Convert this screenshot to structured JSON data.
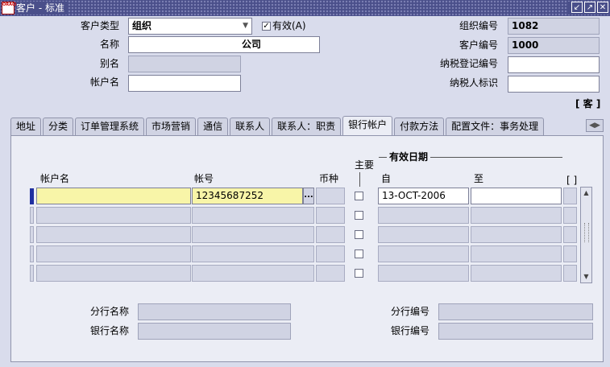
{
  "window": {
    "title": "客户 - 标准",
    "icon_text": "ORACLE"
  },
  "header": {
    "cust_type_label": "客户类型",
    "cust_type_value": "组织",
    "active_label": "有效(A)",
    "name_label": "名称",
    "name_value": "公司",
    "alias_label": "别名",
    "account_name_label": "帐户名",
    "org_number_label": "组织编号",
    "org_number_value": "1082",
    "cust_number_label": "客户编号",
    "cust_number_value": "1000",
    "tax_reg_label": "纳税登记编号",
    "taxpayer_id_label": "纳税人标识",
    "bracket_button": "[ 客 ]"
  },
  "tabs": [
    "地址",
    "分类",
    "订单管理系统",
    "市场营销",
    "通信",
    "联系人",
    "联系人：职责",
    "银行帐户",
    "付款方法",
    "配置文件：事务处理"
  ],
  "grid": {
    "col_account_name": "帐户名",
    "col_account_number": "帐号",
    "col_currency": "币种",
    "col_primary": "主要",
    "group_effective": "有效日期",
    "col_from": "自",
    "col_to": "至",
    "col_bracket": "[ ]",
    "rows": [
      {
        "account_name": "",
        "account_number": "12345687252",
        "from": "13-OCT-2006",
        "to": ""
      },
      {
        "account_name": "",
        "account_number": "",
        "from": "",
        "to": ""
      },
      {
        "account_name": "",
        "account_number": "",
        "from": "",
        "to": ""
      },
      {
        "account_name": "",
        "account_number": "",
        "from": "",
        "to": ""
      },
      {
        "account_name": "",
        "account_number": "",
        "from": "",
        "to": ""
      }
    ],
    "lov_button": "..."
  },
  "footer": {
    "branch_name_label": "分行名称",
    "bank_name_label": "银行名称",
    "branch_number_label": "分行编号",
    "bank_number_label": "银行编号"
  }
}
